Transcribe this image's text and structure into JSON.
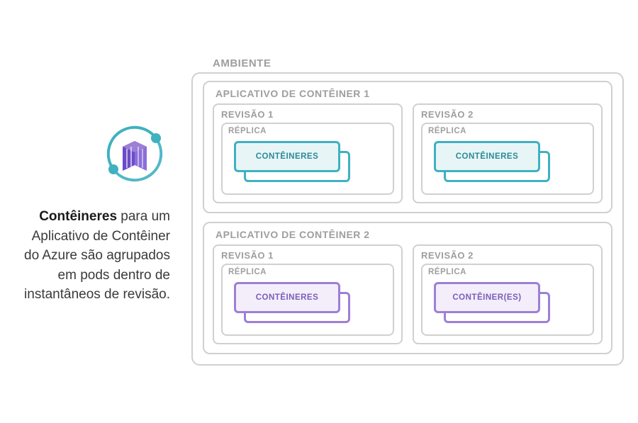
{
  "caption": {
    "bold_prefix": "Contêineres",
    "rest": " para um Aplicativo de Contêiner do Azure são agrupados em pods dentro de instantâneos de revisão."
  },
  "environment": {
    "label": "AMBIENTE"
  },
  "apps": [
    {
      "header": "APLICATIVO DE CONTÊINER 1",
      "color": "teal",
      "revisions": [
        {
          "header": "REVISÃO 1",
          "replica_header": "RÉPLICA",
          "container_label": "CONTÊINERES"
        },
        {
          "header": "REVISÃO 2",
          "replica_header": "RÉPLICA",
          "container_label": "CONTÊINERES"
        }
      ]
    },
    {
      "header": "APLICATIVO DE CONTÊINER 2",
      "color": "purple",
      "revisions": [
        {
          "header": "REVISÃO 1",
          "replica_header": "RÉPLICA",
          "container_label": "CONTÊINERES"
        },
        {
          "header": "REVISÃO 2",
          "replica_header": "RÉPLICA",
          "container_label": "CONTÊINER(ES)"
        }
      ]
    }
  ]
}
